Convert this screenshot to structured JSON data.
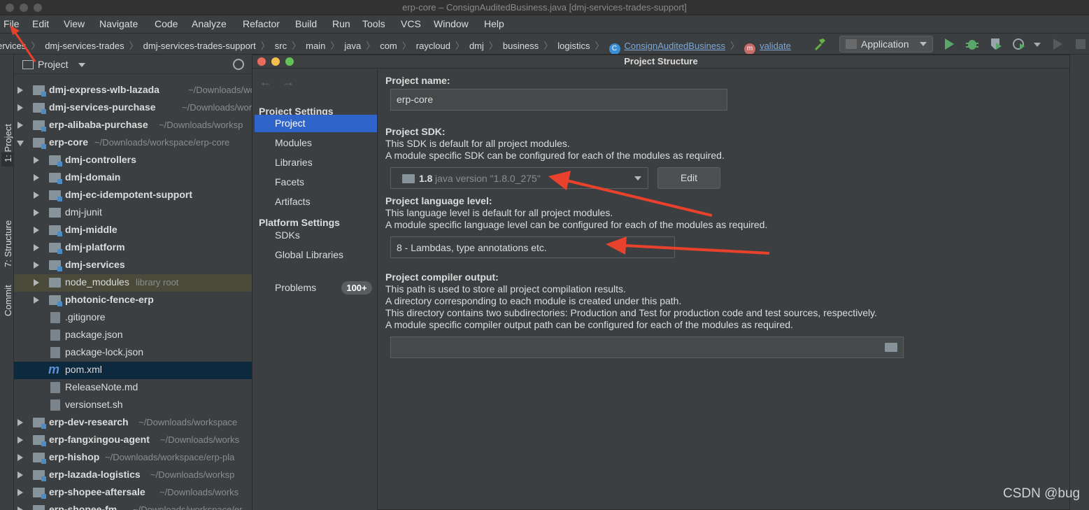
{
  "window": {
    "title": "erp-core – ConsignAuditedBusiness.java [dmj-services-trades-support]"
  },
  "menu": [
    "File",
    "Edit",
    "View",
    "Navigate",
    "Code",
    "Analyze",
    "Refactor",
    "Build",
    "Run",
    "Tools",
    "VCS",
    "Window",
    "Help"
  ],
  "breadcrumbs": [
    "ervices",
    "dmj-services-trades",
    "dmj-services-trades-support",
    "src",
    "main",
    "java",
    "com",
    "raycloud",
    "dmj",
    "business",
    "logistics"
  ],
  "breadcrumb_class": {
    "badge": "C",
    "label": "ConsignAuditedBusiness"
  },
  "breadcrumb_method": {
    "badge": "m",
    "label": "validate"
  },
  "run_config": "Application",
  "tool_tabs": {
    "project": "1: Project",
    "structure": "7: Structure",
    "commit": "Commit"
  },
  "project_panel": {
    "title": "Project",
    "tree": [
      {
        "name": "dmj-express-wlb-lazada",
        "path": "~/Downloads/wor"
      },
      {
        "name": "dmj-services-purchase",
        "path": "~/Downloads/work"
      },
      {
        "name": "erp-alibaba-purchase",
        "path": "~/Downloads/worksp"
      },
      {
        "name": "erp-core",
        "path": "~/Downloads/workspace/erp-core"
      },
      {
        "name": "dmj-controllers",
        "path": ""
      },
      {
        "name": "dmj-domain",
        "path": ""
      },
      {
        "name": "dmj-ec-idempotent-support",
        "path": ""
      },
      {
        "name": "dmj-junit",
        "path": ""
      },
      {
        "name": "dmj-middle",
        "path": ""
      },
      {
        "name": "dmj-platform",
        "path": ""
      },
      {
        "name": "dmj-services",
        "path": ""
      },
      {
        "name": "node_modules",
        "path": "library root"
      },
      {
        "name": "photonic-fence-erp",
        "path": ""
      },
      {
        "name": ".gitignore",
        "path": ""
      },
      {
        "name": "package.json",
        "path": ""
      },
      {
        "name": "package-lock.json",
        "path": ""
      },
      {
        "name": "pom.xml",
        "path": ""
      },
      {
        "name": "ReleaseNote.md",
        "path": ""
      },
      {
        "name": "versionset.sh",
        "path": ""
      },
      {
        "name": "erp-dev-research",
        "path": "~/Downloads/workspace"
      },
      {
        "name": "erp-fangxingou-agent",
        "path": "~/Downloads/works"
      },
      {
        "name": "erp-hishop",
        "path": "~/Downloads/workspace/erp-pla"
      },
      {
        "name": "erp-lazada-logistics",
        "path": "~/Downloads/worksp"
      },
      {
        "name": "erp-shopee-aftersale",
        "path": "~/Downloads/works"
      },
      {
        "name": "erp-shopee-fm",
        "path": "~/Downloads/workspace/er"
      }
    ]
  },
  "dialog": {
    "title": "Project Structure",
    "sidebar": {
      "project_settings_heading": "Project Settings",
      "project_settings": [
        "Project",
        "Modules",
        "Libraries",
        "Facets",
        "Artifacts"
      ],
      "platform_settings_heading": "Platform Settings",
      "platform_settings": [
        "SDKs",
        "Global Libraries"
      ],
      "problems": "Problems",
      "problems_badge": "100+"
    },
    "project_name": {
      "label": "Project name:",
      "value": "erp-core"
    },
    "sdk": {
      "label": "Project SDK:",
      "desc1": "This SDK is default for all project modules.",
      "desc2": "A module specific SDK can be configured for each of the modules as required.",
      "version": "1.8",
      "detail": "java version \"1.8.0_275\"",
      "edit_button": "Edit"
    },
    "language_level": {
      "label": "Project language level:",
      "desc1": "This language level is default for all project modules.",
      "desc2": "A module specific language level can be configured for each of the modules as required.",
      "value": "8 - Lambdas, type annotations etc."
    },
    "compiler_output": {
      "label": "Project compiler output:",
      "desc1": "This path is used to store all project compilation results.",
      "desc2": "A directory corresponding to each module is created under this path.",
      "desc3": "This directory contains two subdirectories: Production and Test for production code and test sources, respectively.",
      "desc4": "A module specific compiler output path can be configured for each of the modules as required.",
      "value": ""
    }
  },
  "watermark": "CSDN @bug",
  "colors": {
    "accent": "#2f65ca",
    "annotation_arrow": "#e8412c"
  }
}
